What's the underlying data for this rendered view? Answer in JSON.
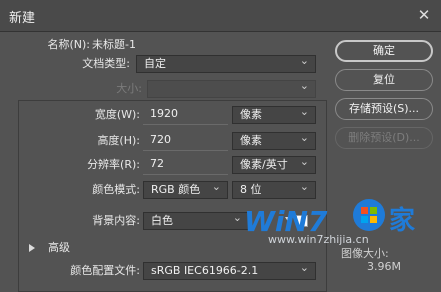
{
  "dialog": {
    "title": "新建"
  },
  "form": {
    "name_label": "名称(N):",
    "name_value": "未标题-1",
    "doc_type_label": "文档类型:",
    "doc_type_value": "自定",
    "size_label": "大小:",
    "size_value": "",
    "width_label": "宽度(W):",
    "width_value": "1920",
    "width_unit": "像素",
    "height_label": "高度(H):",
    "height_value": "720",
    "height_unit": "像素",
    "resolution_label": "分辨率(R):",
    "resolution_value": "72",
    "resolution_unit": "像素/英寸",
    "color_mode_label": "颜色模式:",
    "color_mode_value": "RGB 颜色",
    "bit_depth_value": "8 位",
    "background_label": "背景内容:",
    "background_value": "白色",
    "background_swatch": "#ffffff",
    "advanced_label": "高级",
    "profile_label": "颜色配置文件:",
    "profile_value": "sRGB IEC61966-2.1"
  },
  "buttons": {
    "ok": "确定",
    "reset": "复位",
    "save_preset": "存储预设(S)...",
    "delete_preset": "删除预设(D)..."
  },
  "info": {
    "image_size_label": "图像大小:",
    "image_size_value": "3.96M"
  },
  "watermark": {
    "logo": "WiN7",
    "jia": "家",
    "url": "www.win7zhijia.cn"
  },
  "colors": {
    "dialog_bg": "#535353",
    "field_bg": "#454545",
    "accent_watermark": "#1f7bd8"
  }
}
